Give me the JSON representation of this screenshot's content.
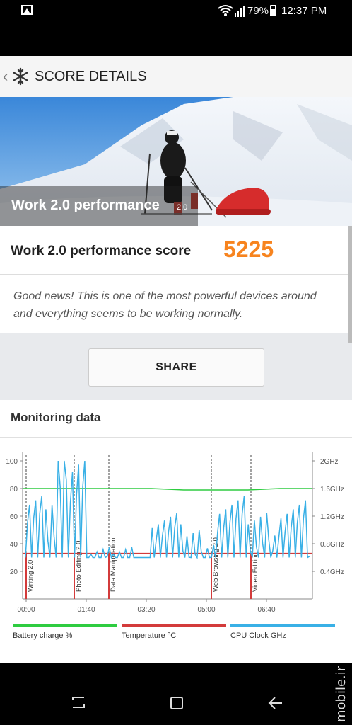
{
  "status_bar": {
    "battery": "79%",
    "time": "12:37 PM"
  },
  "app_bar": {
    "back_glyph": "‹",
    "title": "SCORE DETAILS"
  },
  "hero": {
    "title": "Work 2.0 performance",
    "version": "2.0"
  },
  "score": {
    "label": "Work 2.0 performance score",
    "value": "5225"
  },
  "message": "Good news! This is one of the most powerful devices around and everything seems to be working normally.",
  "share_label": "SHARE",
  "monitoring": {
    "heading": "Monitoring data",
    "chart_data": {
      "type": "line",
      "x_ticks": [
        "00:00",
        "01:40",
        "03:20",
        "05:00",
        "06:40"
      ],
      "y_left_ticks": [
        "100",
        "80",
        "60",
        "40",
        "20"
      ],
      "y_right_ticks": [
        "2GHz",
        "1.6GHz",
        "1.2GHz",
        "0.8GHz",
        "0.4GHz"
      ],
      "markers": [
        "Writing 2.0",
        "Photo Editing 2.0",
        "Data Manipulation",
        "Web Browsing 2.0",
        "Video Editing"
      ],
      "series": [
        {
          "name": "Battery charge %",
          "color": "#2ecc40",
          "values": [
            80,
            80,
            80,
            80,
            80,
            79,
            79,
            79,
            80,
            80
          ]
        },
        {
          "name": "Temperature °C",
          "color": "#d33b3b",
          "values": [
            33,
            33,
            33,
            33,
            33,
            33,
            33,
            33,
            33,
            33
          ]
        },
        {
          "name": "CPU Clock GHz",
          "color": "#39b0e6",
          "values": [
            1.2,
            2.0,
            0.6,
            0.6,
            1.0,
            0.8,
            1.2,
            1.0,
            1.2,
            0.6
          ]
        }
      ]
    }
  },
  "nav_bar": {
    "watermark": "mobile.ir"
  },
  "colors": {
    "score": "#f7841f",
    "battery": "#2ecc40",
    "temperature": "#d33b3b",
    "cpu": "#39b0e6"
  }
}
